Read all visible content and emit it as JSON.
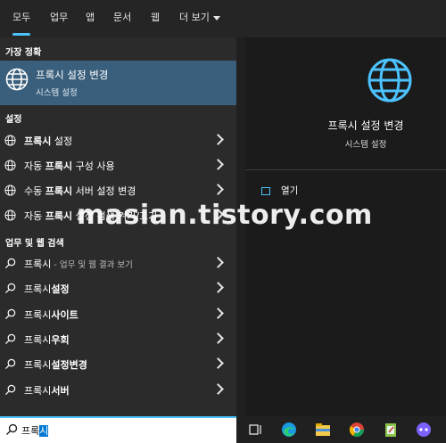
{
  "tabs": [
    {
      "label": "모두",
      "active": true
    },
    {
      "label": "업무"
    },
    {
      "label": "앱"
    },
    {
      "label": "문서"
    },
    {
      "label": "웹"
    },
    {
      "label": "더 보기"
    }
  ],
  "best_match": {
    "header": "가장 정확",
    "title": "프록시 설정 변경",
    "subtitle": "시스템 설정",
    "icon": "globe-icon"
  },
  "settings_section": {
    "header": "설정",
    "items": [
      {
        "bold": "프록시",
        "rest": " 설정"
      },
      {
        "pre": "자동 ",
        "bold": "프록시",
        "rest": " 구성 사용"
      },
      {
        "pre": "수동 ",
        "bold": "프록시",
        "rest": " 서버 설정 변경"
      },
      {
        "pre": "자동 ",
        "bold": "프록시",
        "rest": " 설정 검색 켜기/끄기"
      }
    ]
  },
  "web_section": {
    "header": "업무 및 웹 검색",
    "first": {
      "bold": "프록시",
      "rest": " - 업무 및 웹 결과 보기"
    },
    "items": [
      {
        "normal": "프록시",
        "bold": "설정"
      },
      {
        "normal": "프록시",
        "bold": "사이트"
      },
      {
        "normal": "프록시",
        "bold": "우회"
      },
      {
        "normal": "프록시",
        "bold": "설정변경"
      },
      {
        "normal": "프록시",
        "bold": "서버"
      }
    ]
  },
  "preview": {
    "title": "프록시 설정 변경",
    "subtitle": "시스템 설정",
    "open_label": "열기"
  },
  "search": {
    "typed": "프록",
    "selected": "시"
  },
  "watermark": "masian.tistory.com",
  "colors": {
    "accent": "#4cc2ff",
    "best_bg": "#3a5f7c"
  }
}
